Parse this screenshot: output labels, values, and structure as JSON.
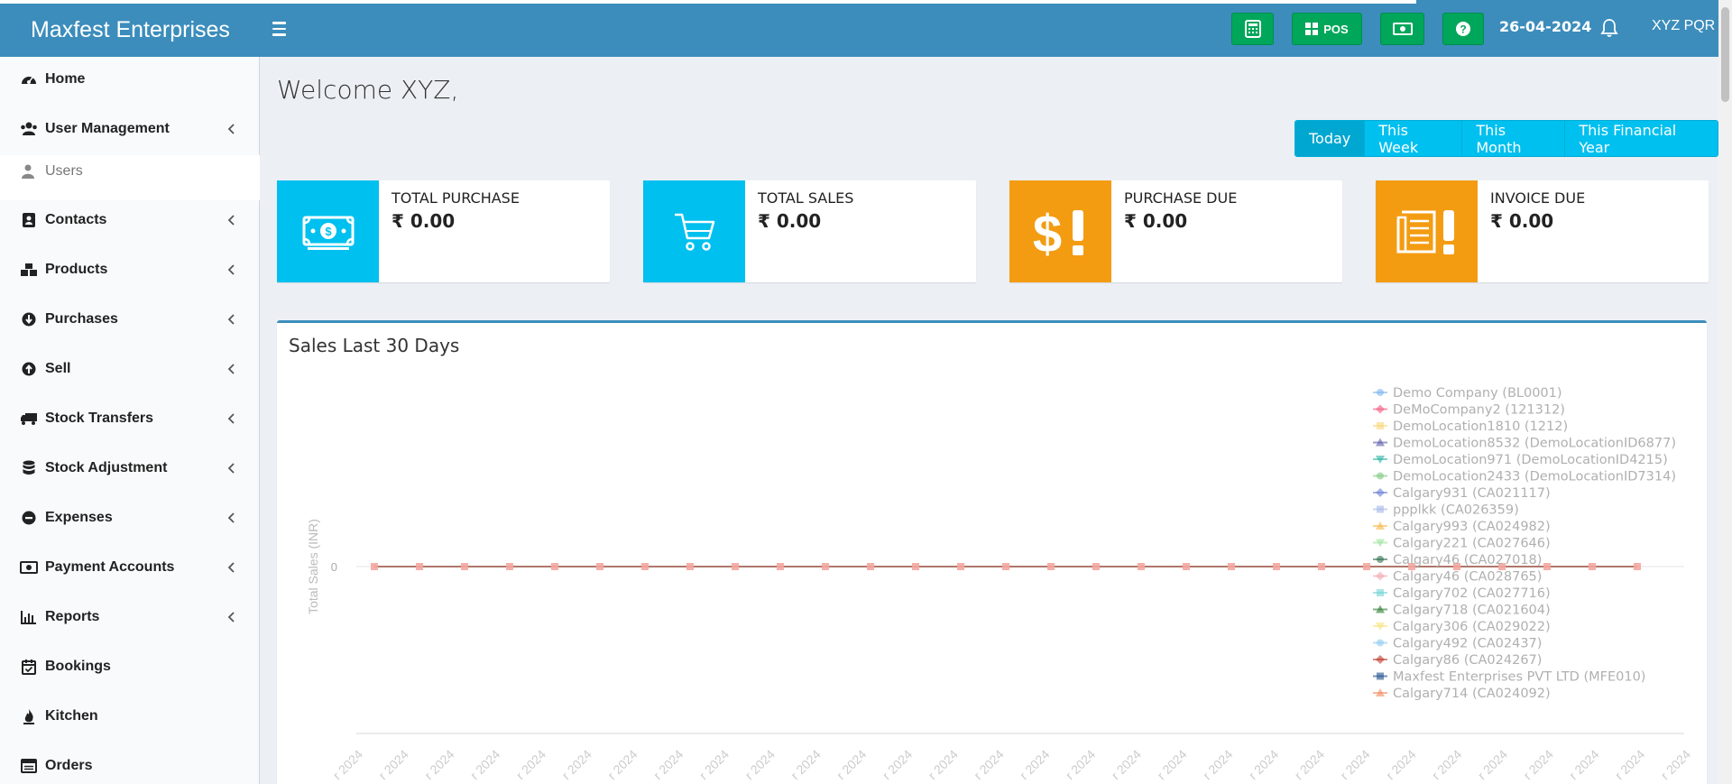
{
  "app": {
    "brand": "Maxfest Enterprises",
    "date": "26-04-2024",
    "user": "XYZ PQR",
    "pos_label": "POS"
  },
  "toolbar_icons": [
    "calculator-icon",
    "pos-icon",
    "cash-icon",
    "help-icon",
    "bell-icon"
  ],
  "sidebar": {
    "items": [
      {
        "label": "Home",
        "icon": "dashboard-icon"
      },
      {
        "label": "User Management",
        "icon": "users-icon"
      },
      {
        "label": "Contacts",
        "icon": "address-book-icon"
      },
      {
        "label": "Products",
        "icon": "cubes-icon"
      },
      {
        "label": "Purchases",
        "icon": "arrow-circle-down-icon"
      },
      {
        "label": "Sell",
        "icon": "arrow-circle-up-icon"
      },
      {
        "label": "Stock Transfers",
        "icon": "truck-icon"
      },
      {
        "label": "Stock Adjustment",
        "icon": "database-icon"
      },
      {
        "label": "Expenses",
        "icon": "minus-circle-icon"
      },
      {
        "label": "Payment Accounts",
        "icon": "money-icon"
      },
      {
        "label": "Reports",
        "icon": "bar-chart-icon"
      },
      {
        "label": "Bookings",
        "icon": "calendar-check-icon"
      },
      {
        "label": "Kitchen",
        "icon": "fire-icon"
      },
      {
        "label": "Orders",
        "icon": "list-alt-icon"
      }
    ],
    "sub_users": "Users"
  },
  "main": {
    "welcome": "Welcome XYZ,",
    "filters": [
      "Today",
      "This Week",
      "This Month",
      "This Financial Year"
    ],
    "active_filter": "Today",
    "cards": [
      {
        "label": "TOTAL PURCHASE",
        "value": "₹ 0.00",
        "color": "#00c0ef",
        "icon": "money-bill-icon"
      },
      {
        "label": "TOTAL SALES",
        "value": "₹ 0.00",
        "color": "#00c0ef",
        "icon": "cart-icon"
      },
      {
        "label": "PURCHASE DUE",
        "value": "₹ 0.00",
        "color": "#f39c12",
        "icon": "dollar-exclamation-icon"
      },
      {
        "label": "INVOICE DUE",
        "value": "₹ 0.00",
        "color": "#f39c12",
        "icon": "invoice-exclamation-icon"
      }
    ]
  },
  "chart_data": {
    "type": "line",
    "title": "Sales Last 30 Days",
    "ylabel": "Total Sales (INR)",
    "y_ticks": [
      "0"
    ],
    "ylim": [
      0,
      0
    ],
    "x_tick_fragment": "r 2024",
    "point_count": 29,
    "legend_position": "right",
    "series": [
      {
        "name": "Demo Company (BL0001)",
        "color": "#7cb5ec",
        "marker": "circle"
      },
      {
        "name": "DeMoCompany2 (121312)",
        "color": "#f15c80",
        "marker": "diamond"
      },
      {
        "name": "DemoLocation1810 (1212)",
        "color": "#f7d774",
        "marker": "square"
      },
      {
        "name": "DemoLocation8532 (DemoLocationID6877)",
        "color": "#5c5ca8",
        "marker": "triangle"
      },
      {
        "name": "DemoLocation971 (DemoLocationID4215)",
        "color": "#2bb3a3",
        "marker": "triangle-down"
      },
      {
        "name": "DemoLocation2433 (DemoLocationID7314)",
        "color": "#7ec97e",
        "marker": "circle"
      },
      {
        "name": "Calgary931 (CA021117)",
        "color": "#6b7fd6",
        "marker": "diamond"
      },
      {
        "name": "ppplkk (CA026359)",
        "color": "#a5b8e8",
        "marker": "square"
      },
      {
        "name": "Calgary993 (CA024982)",
        "color": "#f7b84b",
        "marker": "triangle"
      },
      {
        "name": "Calgary221 (CA027646)",
        "color": "#9be39b",
        "marker": "triangle-down"
      },
      {
        "name": "Calgary46 (CA027018)",
        "color": "#2f6f4f",
        "marker": "circle"
      },
      {
        "name": "Calgary46 (CA028765)",
        "color": "#f4a6b0",
        "marker": "diamond"
      },
      {
        "name": "Calgary702 (CA027716)",
        "color": "#6fd3d3",
        "marker": "square"
      },
      {
        "name": "Calgary718 (CA021604)",
        "color": "#2e7d32",
        "marker": "triangle"
      },
      {
        "name": "Calgary306 (CA029022)",
        "color": "#f9e27a",
        "marker": "triangle-down"
      },
      {
        "name": "Calgary492 (CA02437)",
        "color": "#8ec9f0",
        "marker": "circle"
      },
      {
        "name": "Calgary86 (CA024267)",
        "color": "#c0392b",
        "marker": "diamond"
      },
      {
        "name": "Maxfest Enterprises PVT LTD (MFE010)",
        "color": "#1f4e8c",
        "marker": "square"
      },
      {
        "name": "Calgary714 (CA024092)",
        "color": "#f08a5d",
        "marker": "triangle"
      }
    ]
  }
}
